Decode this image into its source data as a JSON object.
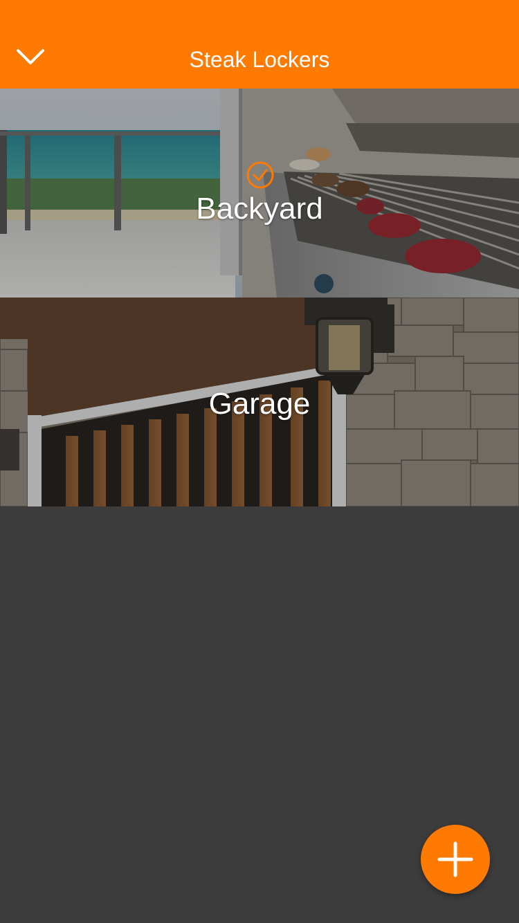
{
  "header": {
    "title": "Steak Lockers",
    "back_icon": "chevron-down-icon",
    "background_color": "#ff7a00"
  },
  "lockers": [
    {
      "label": "Backyard",
      "selected": true,
      "selected_icon": "checkmark-circle-icon",
      "image": "outdoor-grill-balcony"
    },
    {
      "label": "Garage",
      "selected": false,
      "image": "garage-door-stone-wall"
    }
  ],
  "fab": {
    "icon": "plus-icon",
    "color": "#ff7a00"
  },
  "colors": {
    "accent": "#ff7a00",
    "background": "#3c3c3c",
    "text_on_accent": "#ffffff"
  }
}
